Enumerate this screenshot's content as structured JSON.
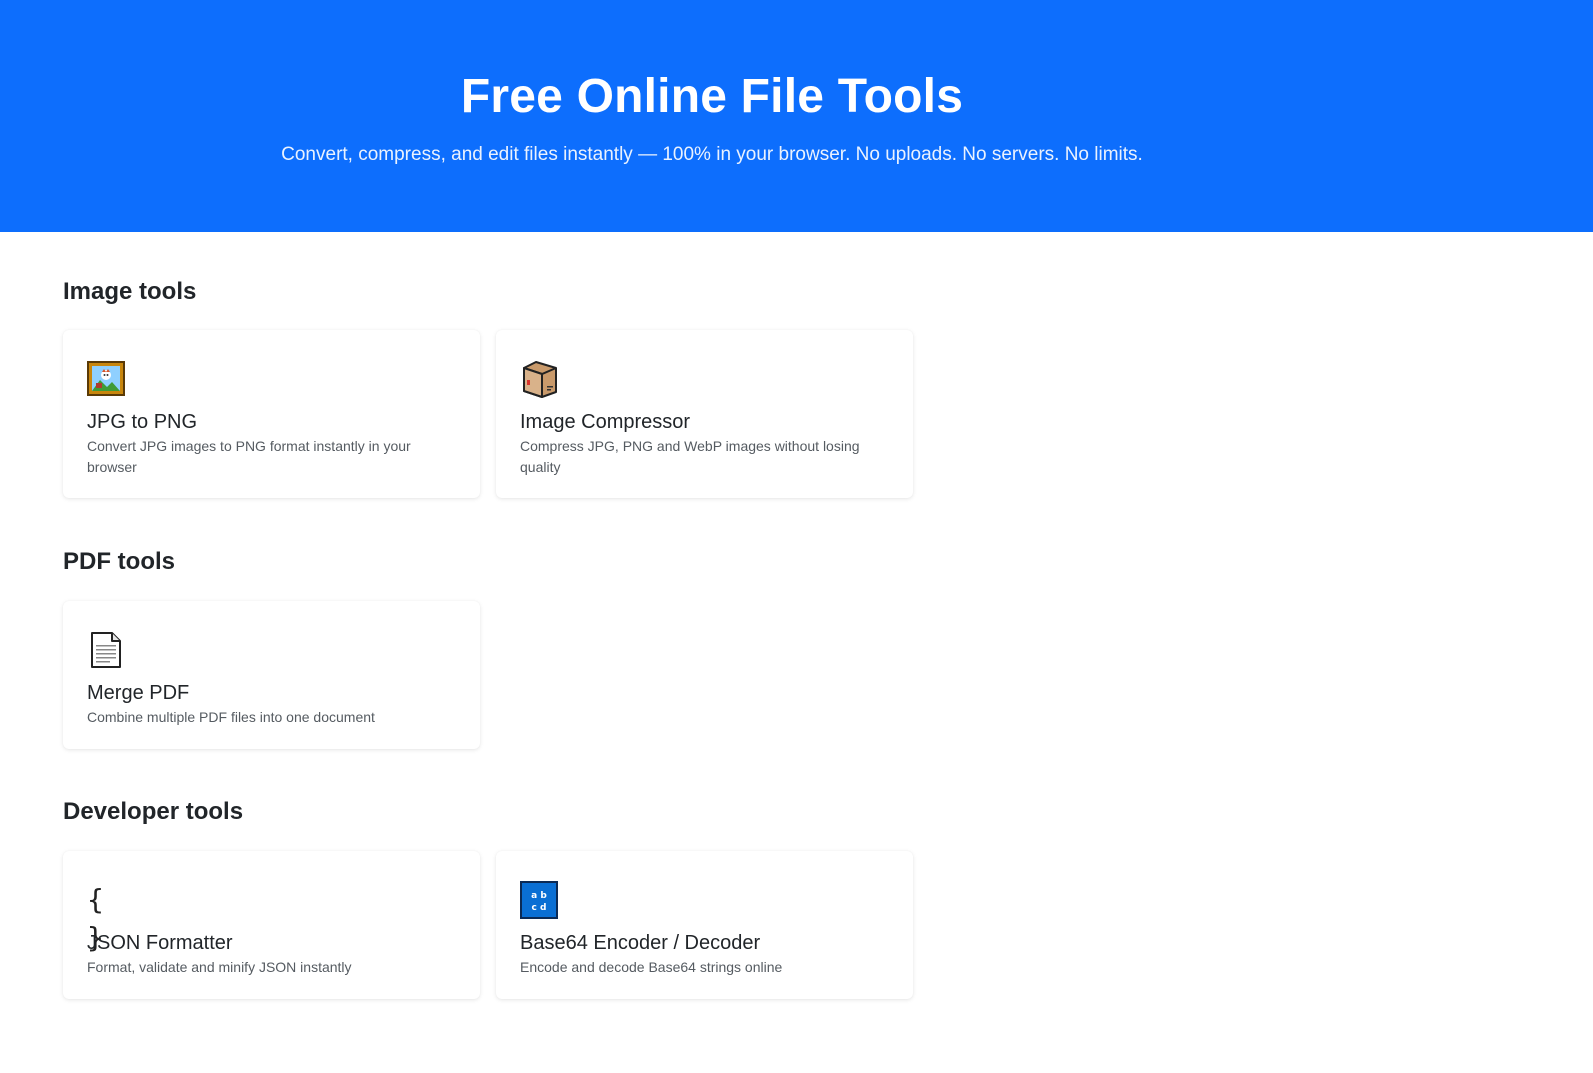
{
  "hero": {
    "title": "Free Online File Tools",
    "subtitle": "Convert, compress, and edit files instantly — 100% in your browser. No uploads. No servers. No limits."
  },
  "sections": [
    {
      "title": "Image tools",
      "tools": [
        {
          "title": "JPG to PNG",
          "description": "Convert JPG images to PNG format instantly in your browser",
          "icon": "framed-picture-icon"
        },
        {
          "title": "Image Compressor",
          "description": "Compress JPG, PNG and WebP images without losing quality",
          "icon": "package-icon"
        }
      ]
    },
    {
      "title": "PDF tools",
      "tools": [
        {
          "title": "Merge PDF",
          "description": "Combine multiple PDF files into one document",
          "icon": "page-icon"
        }
      ]
    },
    {
      "title": "Developer tools",
      "tools": [
        {
          "title": "JSON Formatter",
          "description": "Format, validate and minify JSON instantly",
          "icon": "braces-icon",
          "glyph": "{ }"
        },
        {
          "title": "Base64 Encoder / Decoder",
          "description": "Encode and decode Base64 strings online",
          "icon": "abcd-icon",
          "glyph_top": "a b",
          "glyph_bottom": "c d"
        }
      ]
    }
  ],
  "colors": {
    "hero_bg": "#0d6efd",
    "abcd_icon_bg": "#0a6fd4"
  }
}
